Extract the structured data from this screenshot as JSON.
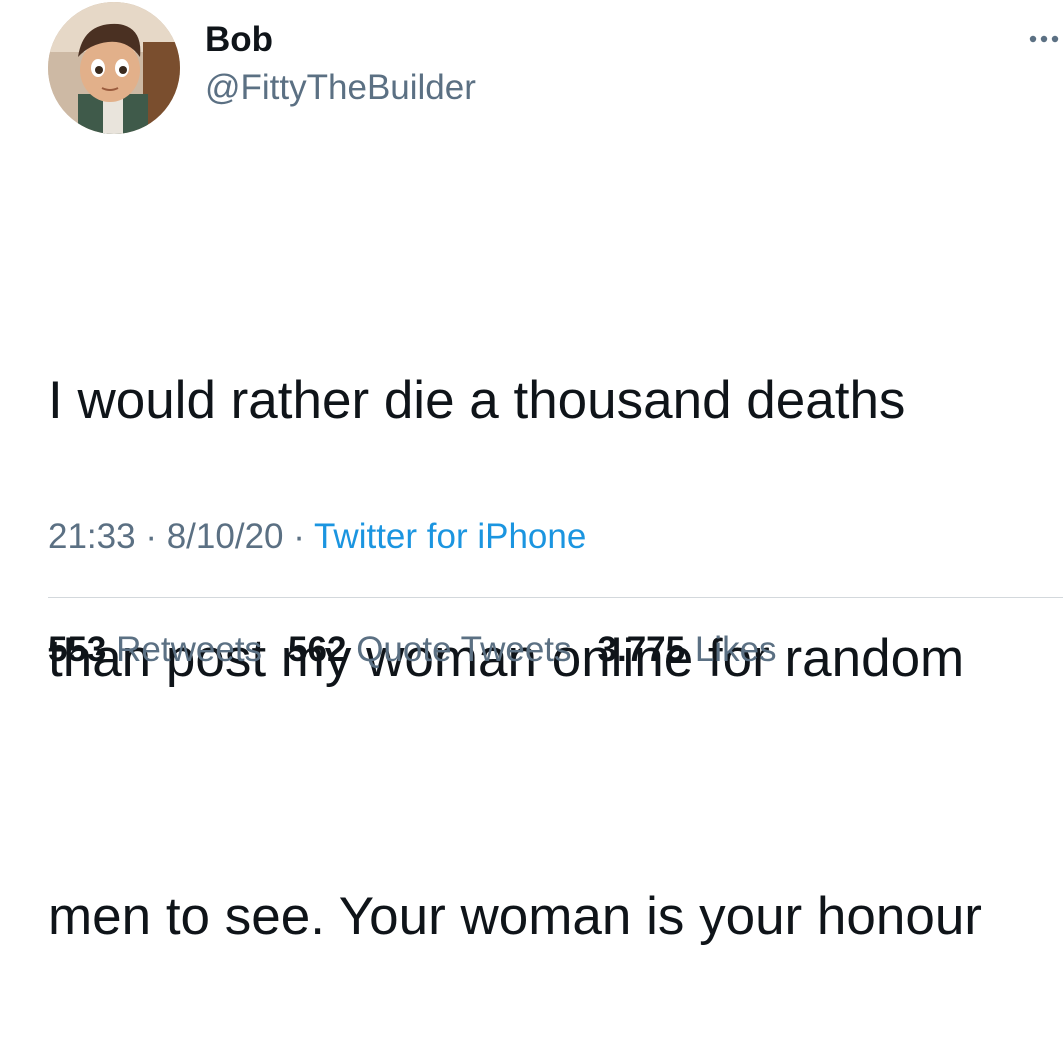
{
  "tweet": {
    "display_name": "Bob",
    "handle": "@FittyTheBuilder",
    "text_lines": [
      "I would rather die a thousand deaths",
      "than post my woman online for random",
      "men to see. Your woman is your honour"
    ],
    "time": "21:33",
    "separator": "·",
    "date": "8/10/20",
    "source": "Twitter for iPhone",
    "more_icon": "more-horizontal-icon"
  },
  "stats": {
    "retweets_count": "553",
    "retweets_label": "Retweets",
    "quote_count": "562",
    "quote_label": "Quote Tweets",
    "likes_count": "3.775",
    "likes_label": "Likes"
  },
  "colors": {
    "text_primary": "#0f1419",
    "text_secondary": "#5b7083",
    "link": "#1b95e0",
    "divider": "#d3d8dc"
  }
}
